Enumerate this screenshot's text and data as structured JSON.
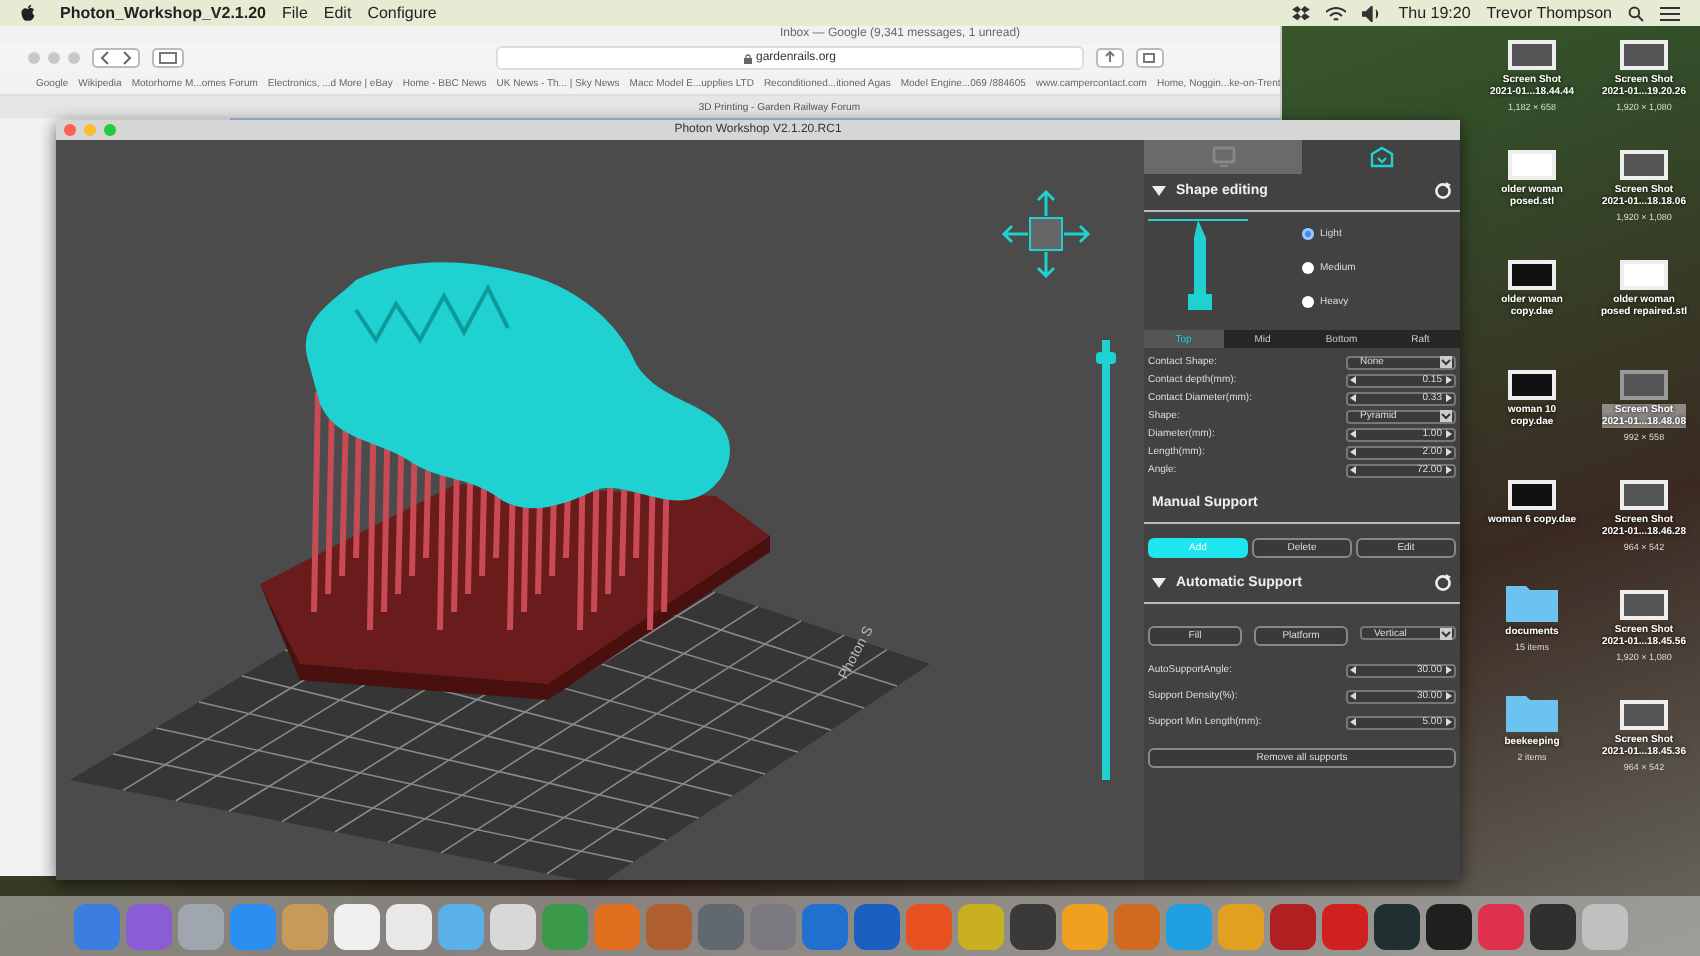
{
  "menubar": {
    "app": "Photon_Workshop_V2.1.20",
    "menus": [
      "File",
      "Edit",
      "Configure"
    ],
    "clock": "Thu 19:20",
    "user": "Trevor Thompson"
  },
  "browser": {
    "title": "Inbox — Google (9,341 messages, 1 unread)",
    "url": "gardenrails.org",
    "bookmarks": [
      "Google",
      "Wikipedia",
      "Motorhome M...omes Forum",
      "Electronics, ...d More | eBay",
      "Home - BBC News",
      "UK News - Th... | Sky News",
      "Macc Model E...upplies LTD",
      "Reconditioned...itioned Agas",
      "Model Engine...069 /884605",
      "www.campercontact.com",
      "Home, Noggin...ke-on-Trent"
    ],
    "tab": "3D Printing - Garden Railway Forum"
  },
  "photon": {
    "title": "Photon Workshop V2.1.20.RC1",
    "panel_tabs": [
      {
        "selected": false
      },
      {
        "selected": true
      }
    ],
    "plate_label": "Photon S",
    "layer_slider": {
      "level": 0.97
    },
    "shape_editing": {
      "title": "Shape editing",
      "density": [
        {
          "label": "Light",
          "selected": true
        },
        {
          "label": "Medium",
          "selected": false
        },
        {
          "label": "Heavy",
          "selected": false
        }
      ],
      "segments": [
        {
          "label": "Top",
          "selected": true
        },
        {
          "label": "Mid",
          "selected": false
        },
        {
          "label": "Bottom",
          "selected": false
        },
        {
          "label": "Raft",
          "selected": false
        }
      ],
      "params": [
        {
          "label": "Contact Shape:",
          "value": "None",
          "kind": "select"
        },
        {
          "label": "Contact depth(mm):",
          "value": "0.15",
          "kind": "spin"
        },
        {
          "label": "Contact Diameter(mm):",
          "value": "0.33",
          "kind": "spin"
        },
        {
          "label": "Shape:",
          "value": "Pyramid",
          "kind": "select"
        },
        {
          "label": "Diameter(mm):",
          "value": "1.00",
          "kind": "spin"
        },
        {
          "label": "Length(mm):",
          "value": "2.00",
          "kind": "spin"
        },
        {
          "label": "Angle:",
          "value": "72.00",
          "kind": "spin"
        }
      ]
    },
    "manual_support": {
      "title": "Manual Support",
      "buttons": [
        {
          "label": "Add",
          "selected": true
        },
        {
          "label": "Delete",
          "selected": false
        },
        {
          "label": "Edit",
          "selected": false
        }
      ]
    },
    "automatic_support": {
      "title": "Automatic Support",
      "buttons": [
        "Fill",
        "Platform"
      ],
      "direction": "Vertical",
      "params": [
        {
          "label": "AutoSupportAngle:",
          "value": "30.00"
        },
        {
          "label": "Support Density(%):",
          "value": "30.00"
        },
        {
          "label": "Support Min Length(mm):",
          "value": "5.00"
        }
      ],
      "remove_button": "Remove all supports"
    }
  },
  "desktop_icons": [
    {
      "name": "Screen Shot",
      "line2": "2021-01...18.44.44",
      "info": "1,182 × 658",
      "kind": "screenshot",
      "selected": false
    },
    {
      "name": "Screen Shot",
      "line2": "2021-01...19.20.26",
      "info": "1,920 × 1,080",
      "kind": "screenshot",
      "selected": false
    },
    {
      "name": "older woman",
      "line2": "posed.stl",
      "kind": "model",
      "selected": false
    },
    {
      "name": "Screen Shot",
      "line2": "2021-01...18.18.06",
      "info": "1,920 × 1,080",
      "kind": "screenshot",
      "selected": false
    },
    {
      "name": "older woman",
      "line2": "copy.dae",
      "kind": "figure",
      "selected": false
    },
    {
      "name": "older woman",
      "line2": "posed repaired.stl",
      "kind": "model",
      "selected": false
    },
    {
      "name": "woman 10",
      "line2": "copy.dae",
      "kind": "figure",
      "selected": false
    },
    {
      "name": "Screen Shot",
      "line2": "2021-01...18.48.08",
      "info": "992 × 558",
      "kind": "screenshot",
      "selected": true
    },
    {
      "name": "woman 6 copy.dae",
      "kind": "figure",
      "selected": false
    },
    {
      "name": "Screen Shot",
      "line2": "2021-01...18.46.28",
      "info": "964 × 542",
      "kind": "screenshot",
      "selected": false
    },
    {
      "name": "documents",
      "info": "15 items",
      "kind": "folder",
      "selected": false
    },
    {
      "name": "Screen Shot",
      "line2": "2021-01...18.45.56",
      "info": "1,920 × 1,080",
      "kind": "screenshot",
      "selected": false
    },
    {
      "name": "beekeeping",
      "info": "2 items",
      "kind": "folder",
      "selected": false
    },
    {
      "name": "Screen Shot",
      "line2": "2021-01...18.45.36",
      "info": "964 × 542",
      "kind": "screenshot",
      "selected": false
    }
  ],
  "dock": [
    {
      "color": "#3b7de0"
    },
    {
      "color": "#8a5cd6"
    },
    {
      "color": "#a0a6b0"
    },
    {
      "color": "#2a8ff0"
    },
    {
      "color": "#c89a5a"
    },
    {
      "color": "#f0f0f0"
    },
    {
      "color": "#e8e8e8"
    },
    {
      "color": "#5ab0e8"
    },
    {
      "color": "#d8d8d8"
    },
    {
      "color": "#3a9a4a"
    },
    {
      "color": "#e07020"
    },
    {
      "color": "#b06030"
    },
    {
      "color": "#606870"
    },
    {
      "color": "#7a7a80"
    },
    {
      "color": "#2070d0"
    },
    {
      "color": "#1a60c0"
    },
    {
      "color": "#e85020"
    },
    {
      "color": "#c8b020"
    },
    {
      "color": "#3a3a3a"
    },
    {
      "color": "#f0a020"
    },
    {
      "color": "#d06a20"
    },
    {
      "color": "#20a0e0"
    },
    {
      "color": "#e0a020"
    },
    {
      "color": "#b02020"
    },
    {
      "color": "#d02020"
    },
    {
      "color": "#203030"
    },
    {
      "color": "#202020"
    },
    {
      "color": "#e03050"
    },
    {
      "color": "#303030"
    },
    {
      "color": "#c0c0c0"
    }
  ]
}
